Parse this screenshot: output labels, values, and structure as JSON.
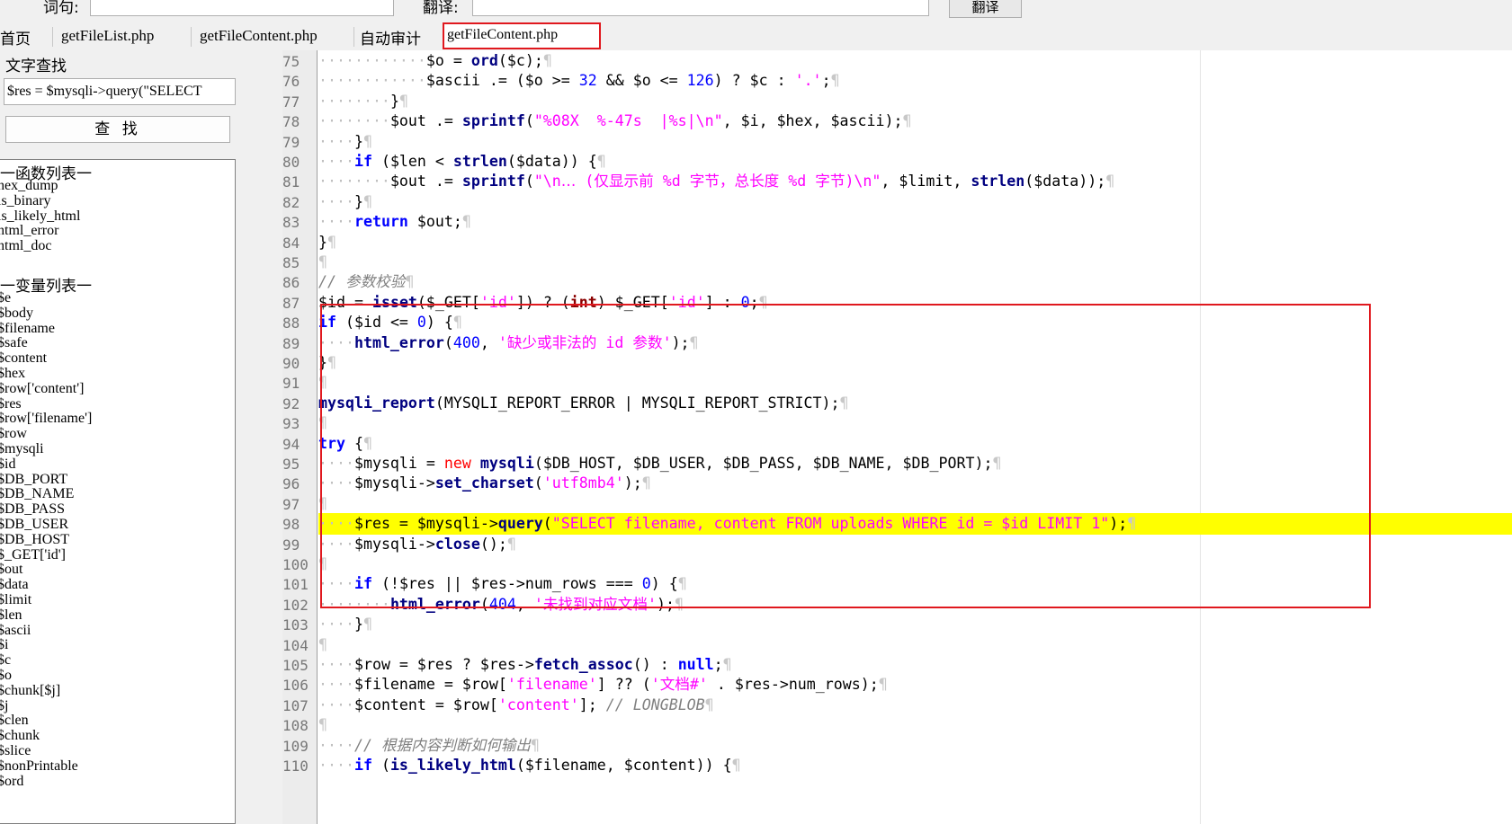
{
  "top": {
    "word_label": "词句:",
    "translate_label": "翻译:",
    "translate_button": "翻译",
    "word_value": "",
    "translate_value": ""
  },
  "tabs": [
    {
      "label": "首页"
    },
    {
      "label": "getFileList.php"
    },
    {
      "label": "getFileContent.php"
    },
    {
      "label": "自动审计"
    },
    {
      "label": "getFileContent.php",
      "active": true
    }
  ],
  "find": {
    "title": "文字查找",
    "input_value": "$res = $mysqli->query(\"SELECT",
    "button": "查 找"
  },
  "functions": {
    "header": "一函数列表一",
    "items": [
      "hex_dump",
      "is_binary",
      "is_likely_html",
      "html_error",
      "html_doc"
    ]
  },
  "variables": {
    "header": "一变量列表一",
    "items": [
      "$e",
      "$body",
      "$filename",
      "$safe",
      "$content",
      "$hex",
      "$row['content']",
      "$res",
      "$row['filename']",
      "$row",
      "$mysqli",
      "$id",
      "$DB_PORT",
      "$DB_NAME",
      "$DB_PASS",
      "$DB_USER",
      "$DB_HOST",
      "$_GET['id']",
      "$out",
      "$data",
      "$limit",
      "$len",
      "$ascii",
      "$i",
      "$c",
      "$o",
      "$chunk[$j]",
      "$j",
      "$clen",
      "$chunk",
      "$slice",
      "$nonPrintable",
      "$ord"
    ]
  },
  "editor": {
    "highlight_line": "98",
    "lines": [
      {
        "n": "75",
        "t": "            $o = ord($c);"
      },
      {
        "n": "76",
        "t": "            $ascii .= ($o >= 32 && $o <= 126) ? $c : '.';"
      },
      {
        "n": "77",
        "t": "        }"
      },
      {
        "n": "78",
        "t": "        $out .= sprintf(\"%08X  %-47s  |%s|\\n\", $i, $hex, $ascii);"
      },
      {
        "n": "79",
        "t": "    }"
      },
      {
        "n": "80",
        "t": "    if ($len < strlen($data)) {"
      },
      {
        "n": "81",
        "t": "        $out .= sprintf(\"\\n… (仅显示前 %d 字节，总长度 %d 字节)\\n\", $limit, strlen($data));"
      },
      {
        "n": "82",
        "t": "    }"
      },
      {
        "n": "83",
        "t": "    return $out;"
      },
      {
        "n": "84",
        "t": "}"
      },
      {
        "n": "85",
        "t": ""
      },
      {
        "n": "86",
        "t": "// 参数校验"
      },
      {
        "n": "87",
        "t": "$id = isset($_GET['id']) ? (int) $_GET['id'] : 0;"
      },
      {
        "n": "88",
        "t": "if ($id <= 0) {"
      },
      {
        "n": "89",
        "t": "    html_error(400, '缺少或非法的 id 参数');"
      },
      {
        "n": "90",
        "t": "}"
      },
      {
        "n": "91",
        "t": ""
      },
      {
        "n": "92",
        "t": "mysqli_report(MYSQLI_REPORT_ERROR | MYSQLI_REPORT_STRICT);"
      },
      {
        "n": "93",
        "t": ""
      },
      {
        "n": "94",
        "t": "try {"
      },
      {
        "n": "95",
        "t": "    $mysqli = new mysqli($DB_HOST, $DB_USER, $DB_PASS, $DB_NAME, $DB_PORT);"
      },
      {
        "n": "96",
        "t": "    $mysqli->set_charset('utf8mb4');"
      },
      {
        "n": "97",
        "t": ""
      },
      {
        "n": "98",
        "t": "    $res = $mysqli->query(\"SELECT filename, content FROM uploads WHERE id = $id LIMIT 1\");"
      },
      {
        "n": "99",
        "t": "    $mysqli->close();"
      },
      {
        "n": "100",
        "t": ""
      },
      {
        "n": "101",
        "t": "    if (!$res || $res->num_rows === 0) {"
      },
      {
        "n": "102",
        "t": "        html_error(404, '未找到对应文档');"
      },
      {
        "n": "103",
        "t": "    }"
      },
      {
        "n": "104",
        "t": ""
      },
      {
        "n": "105",
        "t": "    $row = $res ? $res->fetch_assoc() : null;"
      },
      {
        "n": "106",
        "t": "    $filename = $row['filename'] ?? ('文档#' . $res->num_rows);"
      },
      {
        "n": "107",
        "t": "    $content = $row['content']; // LONGBLOB"
      },
      {
        "n": "108",
        "t": ""
      },
      {
        "n": "109",
        "t": "    // 根据内容判断如何输出"
      },
      {
        "n": "110",
        "t": "    if (is_likely_html($filename, $content)) {"
      }
    ]
  },
  "colors": {
    "keyword": "#0000ff",
    "string": "#ff00ff",
    "comment": "#808080",
    "function": "#000080",
    "highlight": "#ffff00",
    "annotation": "#e0181e"
  }
}
